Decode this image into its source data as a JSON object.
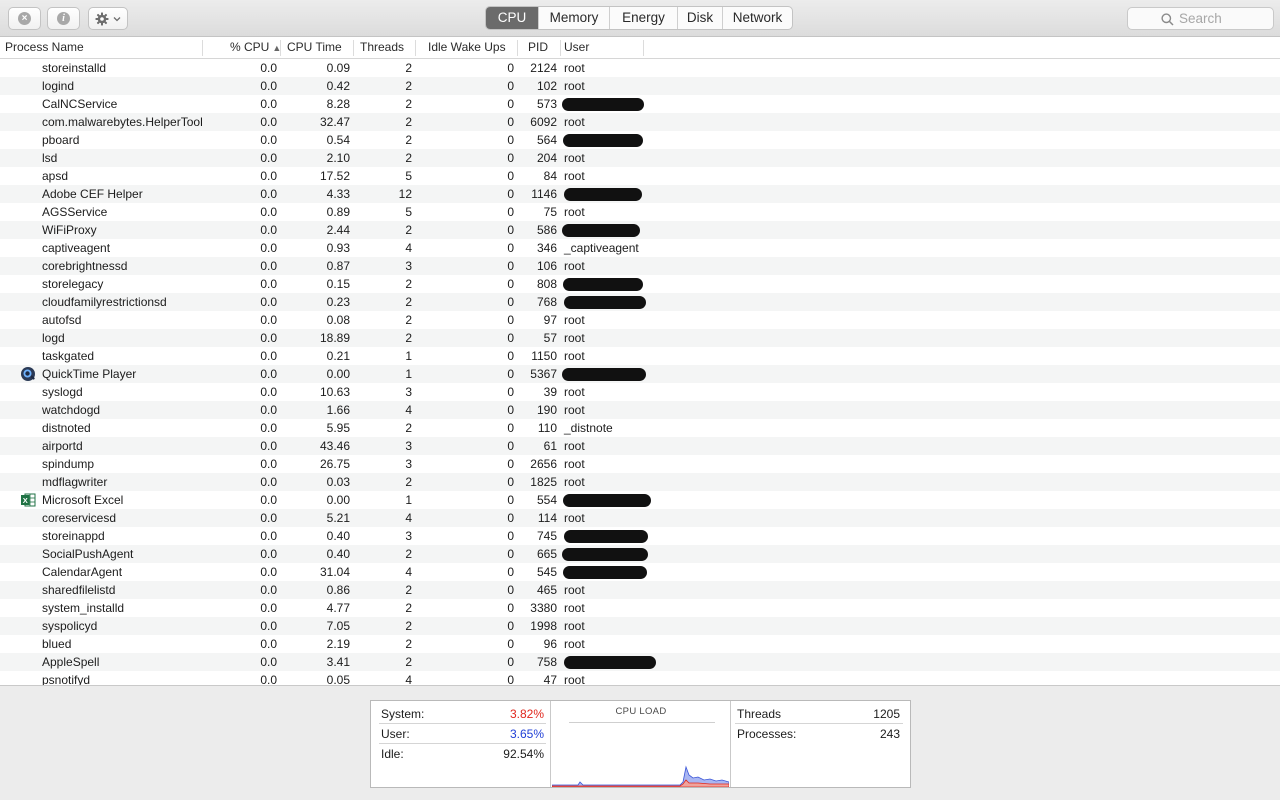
{
  "toolbar": {
    "close_icon": "x-circle-icon",
    "info_icon": "info-circle-icon",
    "gear_icon": "gear-icon",
    "tabs": [
      {
        "label": "CPU",
        "active": true
      },
      {
        "label": "Memory",
        "active": false
      },
      {
        "label": "Energy",
        "active": false
      },
      {
        "label": "Disk",
        "active": false
      },
      {
        "label": "Network",
        "active": false
      }
    ],
    "search_placeholder": "Search"
  },
  "columns": {
    "name": "Process Name",
    "cpu": "% CPU",
    "cpu_time": "CPU Time",
    "threads": "Threads",
    "idle_wake": "Idle Wake Ups",
    "pid": "PID",
    "user": "User"
  },
  "processes": [
    {
      "name": "storeinstalld",
      "cpu": "0.0",
      "time": "0.09",
      "threads": "2",
      "wake": "0",
      "pid": "2124",
      "user": "root"
    },
    {
      "name": "logind",
      "cpu": "0.0",
      "time": "0.42",
      "threads": "2",
      "wake": "0",
      "pid": "102",
      "user": "root"
    },
    {
      "name": "CalNCService",
      "cpu": "0.0",
      "time": "8.28",
      "threads": "2",
      "wake": "0",
      "pid": "573",
      "user": ""
    },
    {
      "name": "com.malwarebytes.HelperTool",
      "cpu": "0.0",
      "time": "32.47",
      "threads": "2",
      "wake": "0",
      "pid": "6092",
      "user": "root"
    },
    {
      "name": "pboard",
      "cpu": "0.0",
      "time": "0.54",
      "threads": "2",
      "wake": "0",
      "pid": "564",
      "user": ""
    },
    {
      "name": "lsd",
      "cpu": "0.0",
      "time": "2.10",
      "threads": "2",
      "wake": "0",
      "pid": "204",
      "user": "root"
    },
    {
      "name": "apsd",
      "cpu": "0.0",
      "time": "17.52",
      "threads": "5",
      "wake": "0",
      "pid": "84",
      "user": "root"
    },
    {
      "name": "Adobe CEF Helper",
      "cpu": "0.0",
      "time": "4.33",
      "threads": "12",
      "wake": "0",
      "pid": "1146",
      "user": ""
    },
    {
      "name": "AGSService",
      "cpu": "0.0",
      "time": "0.89",
      "threads": "5",
      "wake": "0",
      "pid": "75",
      "user": "root"
    },
    {
      "name": "WiFiProxy",
      "cpu": "0.0",
      "time": "2.44",
      "threads": "2",
      "wake": "0",
      "pid": "586",
      "user": ""
    },
    {
      "name": "captiveagent",
      "cpu": "0.0",
      "time": "0.93",
      "threads": "4",
      "wake": "0",
      "pid": "346",
      "user": "_captiveagent"
    },
    {
      "name": "corebrightnessd",
      "cpu": "0.0",
      "time": "0.87",
      "threads": "3",
      "wake": "0",
      "pid": "106",
      "user": "root"
    },
    {
      "name": "storelegacy",
      "cpu": "0.0",
      "time": "0.15",
      "threads": "2",
      "wake": "0",
      "pid": "808",
      "user": ""
    },
    {
      "name": "cloudfamilyrestrictionsd",
      "cpu": "0.0",
      "time": "0.23",
      "threads": "2",
      "wake": "0",
      "pid": "768",
      "user": ""
    },
    {
      "name": "autofsd",
      "cpu": "0.0",
      "time": "0.08",
      "threads": "2",
      "wake": "0",
      "pid": "97",
      "user": "root"
    },
    {
      "name": "logd",
      "cpu": "0.0",
      "time": "18.89",
      "threads": "2",
      "wake": "0",
      "pid": "57",
      "user": "root"
    },
    {
      "name": "taskgated",
      "cpu": "0.0",
      "time": "0.21",
      "threads": "1",
      "wake": "0",
      "pid": "1150",
      "user": "root"
    },
    {
      "name": "QuickTime Player",
      "cpu": "0.0",
      "time": "0.00",
      "threads": "1",
      "wake": "0",
      "pid": "5367",
      "user": "",
      "icon": "quicktime-icon"
    },
    {
      "name": "syslogd",
      "cpu": "0.0",
      "time": "10.63",
      "threads": "3",
      "wake": "0",
      "pid": "39",
      "user": "root"
    },
    {
      "name": "watchdogd",
      "cpu": "0.0",
      "time": "1.66",
      "threads": "4",
      "wake": "0",
      "pid": "190",
      "user": "root"
    },
    {
      "name": "distnoted",
      "cpu": "0.0",
      "time": "5.95",
      "threads": "2",
      "wake": "0",
      "pid": "110",
      "user": "_distnote"
    },
    {
      "name": "airportd",
      "cpu": "0.0",
      "time": "43.46",
      "threads": "3",
      "wake": "0",
      "pid": "61",
      "user": "root"
    },
    {
      "name": "spindump",
      "cpu": "0.0",
      "time": "26.75",
      "threads": "3",
      "wake": "0",
      "pid": "2656",
      "user": "root"
    },
    {
      "name": "mdflagwriter",
      "cpu": "0.0",
      "time": "0.03",
      "threads": "2",
      "wake": "0",
      "pid": "1825",
      "user": "root"
    },
    {
      "name": "Microsoft Excel",
      "cpu": "0.0",
      "time": "0.00",
      "threads": "1",
      "wake": "0",
      "pid": "554",
      "user": "",
      "icon": "excel-icon"
    },
    {
      "name": "coreservicesd",
      "cpu": "0.0",
      "time": "5.21",
      "threads": "4",
      "wake": "0",
      "pid": "114",
      "user": "root"
    },
    {
      "name": "storeinappd",
      "cpu": "0.0",
      "time": "0.40",
      "threads": "3",
      "wake": "0",
      "pid": "745",
      "user": ""
    },
    {
      "name": "SocialPushAgent",
      "cpu": "0.0",
      "time": "0.40",
      "threads": "2",
      "wake": "0",
      "pid": "665",
      "user": ""
    },
    {
      "name": "CalendarAgent",
      "cpu": "0.0",
      "time": "31.04",
      "threads": "4",
      "wake": "0",
      "pid": "545",
      "user": ""
    },
    {
      "name": "sharedfilelistd",
      "cpu": "0.0",
      "time": "0.86",
      "threads": "2",
      "wake": "0",
      "pid": "465",
      "user": "root"
    },
    {
      "name": "system_installd",
      "cpu": "0.0",
      "time": "4.77",
      "threads": "2",
      "wake": "0",
      "pid": "3380",
      "user": "root"
    },
    {
      "name": "syspolicyd",
      "cpu": "0.0",
      "time": "7.05",
      "threads": "2",
      "wake": "0",
      "pid": "1998",
      "user": "root"
    },
    {
      "name": "blued",
      "cpu": "0.0",
      "time": "2.19",
      "threads": "2",
      "wake": "0",
      "pid": "96",
      "user": "root"
    },
    {
      "name": "AppleSpell",
      "cpu": "0.0",
      "time": "3.41",
      "threads": "2",
      "wake": "0",
      "pid": "758",
      "user": ""
    },
    {
      "name": "psnotifyd",
      "cpu": "0.0",
      "time": "0.05",
      "threads": "4",
      "wake": "0",
      "pid": "47",
      "user": "root"
    }
  ],
  "stats": {
    "system_label": "System:",
    "system_value": "3.82%",
    "user_label": "User:",
    "user_value": "3.65%",
    "idle_label": "Idle:",
    "idle_value": "92.54%",
    "cpu_load_title": "CPU LOAD",
    "threads_label": "Threads",
    "threads_value": "1205",
    "processes_label": "Processes:",
    "processes_value": "243",
    "colors": {
      "system": "#e0271d",
      "user": "#1f3fd6"
    }
  }
}
